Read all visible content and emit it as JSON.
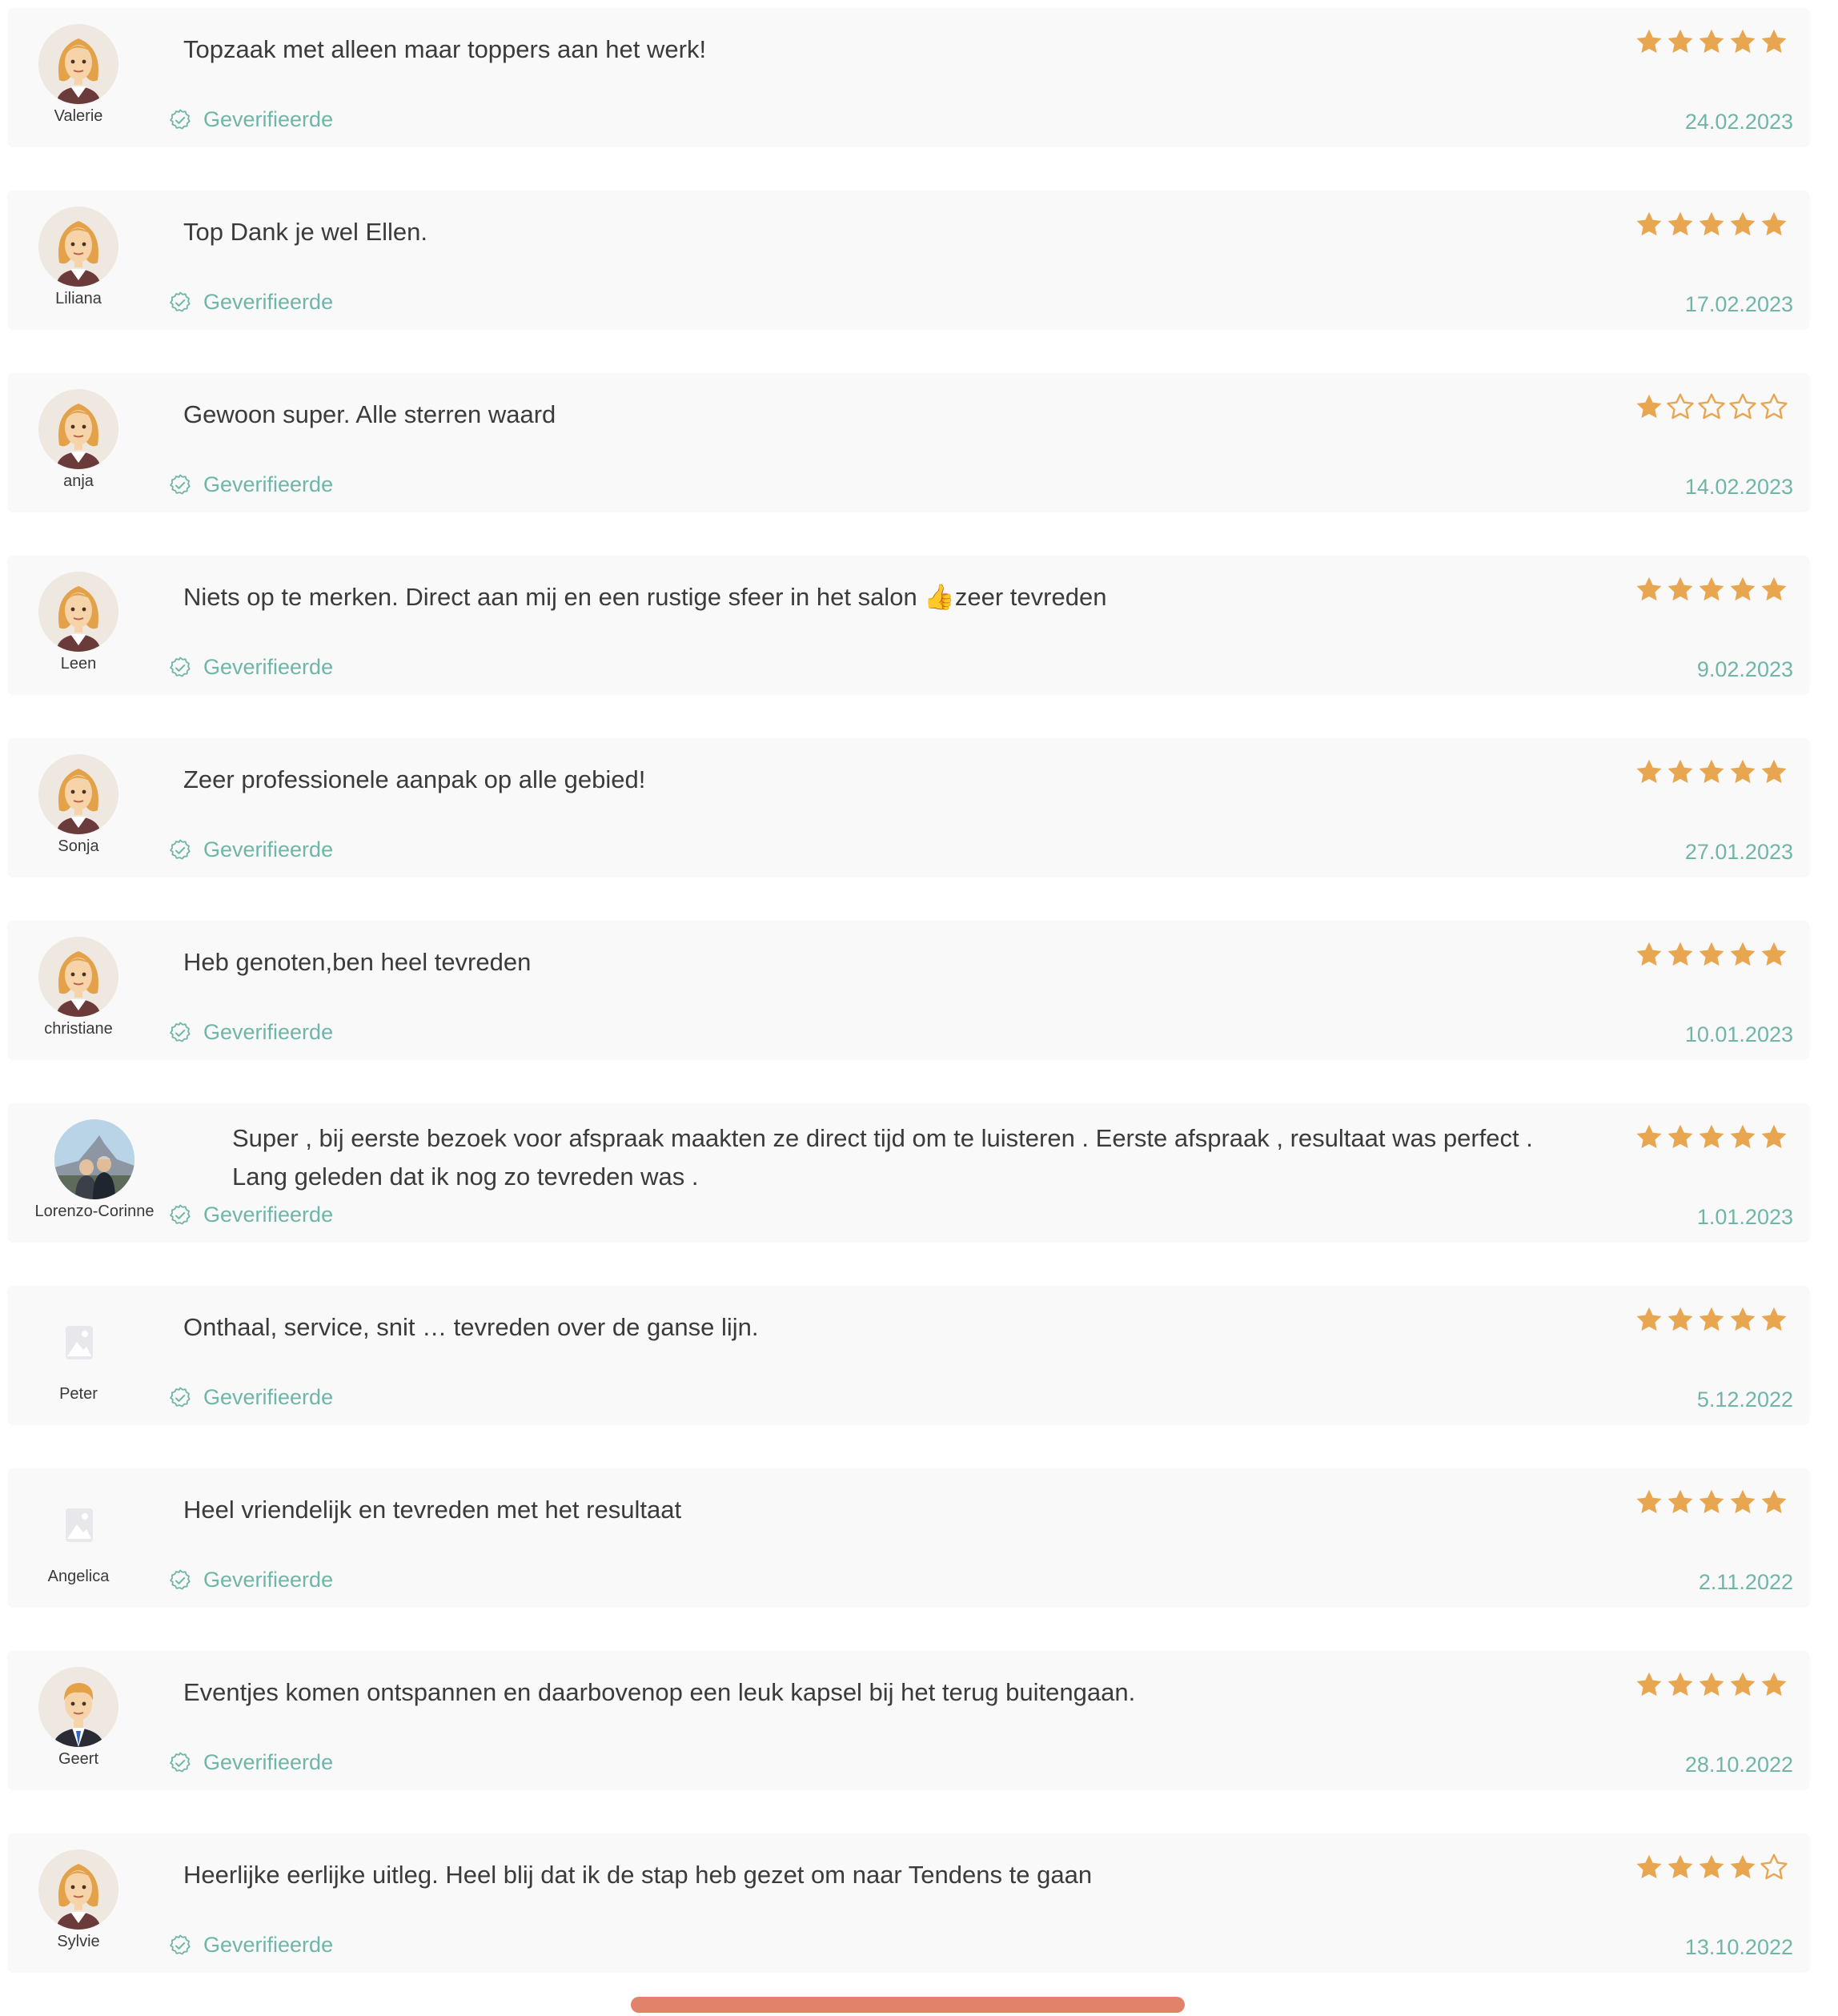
{
  "reviews": [
    {
      "author": "Valerie",
      "avatar": "female-avatar",
      "text": "Topzaak met alleen maar toppers aan het werk!",
      "verified_label": "Geverifieerde",
      "rating": 5,
      "date": "24.02.2023"
    },
    {
      "author": "Liliana",
      "avatar": "female-avatar",
      "text": "Top Dank je wel Ellen.",
      "verified_label": "Geverifieerde",
      "rating": 5,
      "date": "17.02.2023"
    },
    {
      "author": "anja",
      "avatar": "female-avatar",
      "text": "Gewoon super. Alle sterren waard",
      "verified_label": "Geverifieerde",
      "rating": 1,
      "date": "14.02.2023"
    },
    {
      "author": "Leen",
      "avatar": "female-avatar",
      "text": "Niets op te merken. Direct aan mij en een rustige sfeer in het salon 👍zeer tevreden",
      "verified_label": "Geverifieerde",
      "rating": 5,
      "date": "9.02.2023"
    },
    {
      "author": "Sonja",
      "avatar": "female-avatar",
      "text": "Zeer professionele aanpak op alle gebied!",
      "verified_label": "Geverifieerde",
      "rating": 5,
      "date": "27.01.2023"
    },
    {
      "author": "christiane",
      "avatar": "female-avatar",
      "text": "Heb genoten,ben heel tevreden",
      "verified_label": "Geverifieerde",
      "rating": 5,
      "date": "10.01.2023"
    },
    {
      "author": "Lorenzo-Corinne",
      "avatar": "photo-avatar",
      "text": "Super , bij eerste bezoek voor afspraak maakten ze direct tijd om te luisteren . Eerste afspraak , resultaat was perfect . Lang geleden dat ik nog zo tevreden was .",
      "verified_label": "Geverifieerde",
      "rating": 5,
      "date": "1.01.2023"
    },
    {
      "author": "Peter",
      "avatar": "image-placeholder-icon",
      "text": "Onthaal, service, snit … tevreden over de ganse lijn.",
      "verified_label": "Geverifieerde",
      "rating": 5,
      "date": "5.12.2022"
    },
    {
      "author": "Angelica",
      "avatar": "image-placeholder-icon",
      "text": "Heel vriendelijk en tevreden met het resultaat",
      "verified_label": "Geverifieerde",
      "rating": 5,
      "date": "2.11.2022"
    },
    {
      "author": "Geert",
      "avatar": "male-avatar",
      "text": "Eventjes komen ontspannen en daarbovenop een leuk kapsel bij het terug buitengaan.",
      "verified_label": "Geverifieerde",
      "rating": 5,
      "date": "28.10.2022"
    },
    {
      "author": "Sylvie",
      "avatar": "female-avatar",
      "text": "Heerlijke eerlijke uitleg. Heel blij dat ik de stap heb gezet om naar Tendens te gaan",
      "verified_label": "Geverifieerde",
      "rating": 4,
      "date": "13.10.2022"
    }
  ],
  "colors": {
    "star_filled": "#e9a650",
    "star_empty_stroke": "#e9a650",
    "verified": "#6fb5a8",
    "card_bg": "#f9f9f9",
    "button": "#e0836a"
  }
}
